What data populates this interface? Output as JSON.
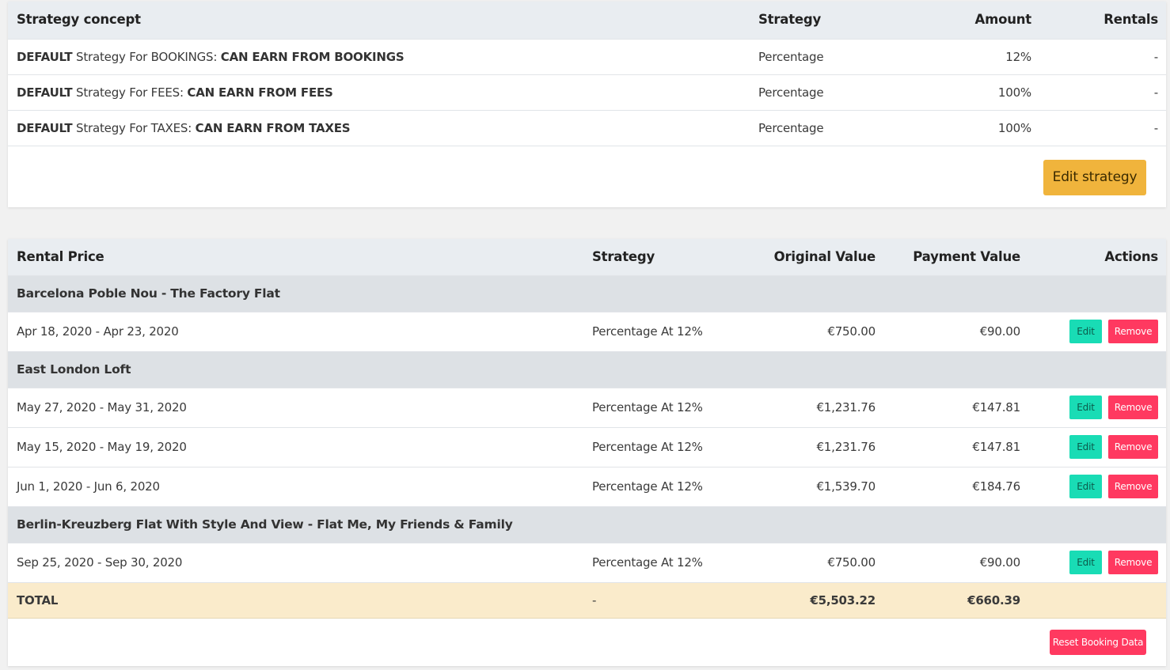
{
  "strategy_table": {
    "headers": {
      "concept": "Strategy concept",
      "strategy": "Strategy",
      "amount": "Amount",
      "rentals": "Rentals"
    },
    "rows": [
      {
        "prefix": "DEFAULT",
        "middle": " Strategy For BOOKINGS: ",
        "suffix": "CAN EARN FROM BOOKINGS",
        "strategy": "Percentage",
        "amount": "12%",
        "rentals": "-"
      },
      {
        "prefix": "DEFAULT",
        "middle": " Strategy For FEES: ",
        "suffix": "CAN EARN FROM FEES",
        "strategy": "Percentage",
        "amount": "100%",
        "rentals": "-"
      },
      {
        "prefix": "DEFAULT",
        "middle": " Strategy For TAXES: ",
        "suffix": "CAN EARN FROM TAXES",
        "strategy": "Percentage",
        "amount": "100%",
        "rentals": "-"
      }
    ],
    "edit_button": "Edit strategy"
  },
  "rental_table": {
    "headers": {
      "rental_price": "Rental Price",
      "strategy": "Strategy",
      "original_value": "Original Value",
      "payment_value": "Payment Value",
      "actions": "Actions"
    },
    "groups": [
      {
        "name": "Barcelona Poble Nou - The Factory Flat",
        "items": [
          {
            "dates": "Apr 18, 2020 - Apr 23, 2020",
            "strategy": "Percentage At 12%",
            "original": "€750.00",
            "payment": "€90.00"
          }
        ]
      },
      {
        "name": "East London Loft",
        "items": [
          {
            "dates": "May 27, 2020 - May 31, 2020",
            "strategy": "Percentage At 12%",
            "original": "€1,231.76",
            "payment": "€147.81"
          },
          {
            "dates": "May 15, 2020 - May 19, 2020",
            "strategy": "Percentage At 12%",
            "original": "€1,231.76",
            "payment": "€147.81"
          },
          {
            "dates": "Jun 1, 2020 - Jun 6, 2020",
            "strategy": "Percentage At 12%",
            "original": "€1,539.70",
            "payment": "€184.76"
          }
        ]
      },
      {
        "name": "Berlin-Kreuzberg Flat With Style And View - Flat Me, My Friends & Family",
        "items": [
          {
            "dates": "Sep 25, 2020 - Sep 30, 2020",
            "strategy": "Percentage At 12%",
            "original": "€750.00",
            "payment": "€90.00"
          }
        ]
      }
    ],
    "edit_label": "Edit",
    "remove_label": "Remove",
    "total": {
      "label": "TOTAL",
      "strategy": "-",
      "original": "€5,503.22",
      "payment": "€660.39"
    },
    "reset_button": "Reset Booking Data"
  },
  "colors": {
    "edit_strategy_button": "#f0b43c",
    "edit_button": "#19dcb5",
    "remove_button": "#ff3960",
    "total_row": "#faebcb",
    "group_row": "#dde1e5",
    "header_row": "#e9edf1"
  }
}
